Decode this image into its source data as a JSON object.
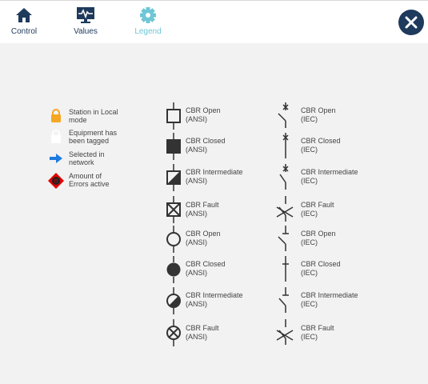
{
  "nav": {
    "tabs": [
      {
        "label": "Control",
        "icon": "home-icon"
      },
      {
        "label": "Values",
        "icon": "monitor-icon"
      },
      {
        "label": "Legend",
        "icon": "gear-icon",
        "active": true
      }
    ],
    "close_icon": "close-icon"
  },
  "colors": {
    "navy": "#1e3a5c",
    "accent": "#6ec6d6",
    "local_mode": "#f5a623",
    "tagged": "#ffffff",
    "selected": "#1e7be0",
    "errors": "#e00000"
  },
  "legend": [
    {
      "icon": "lock-icon",
      "l1": "Station in Local",
      "l2": "mode"
    },
    {
      "icon": "tag-icon",
      "l1": "Equipment has",
      "l2": "been tagged"
    },
    {
      "icon": "arrow-right-icon",
      "l1": "Selected in",
      "l2": "network"
    },
    {
      "icon": "error-diamond-icon",
      "badge": "!!",
      "l1": "Amount of",
      "l2": "Errors active"
    }
  ],
  "symbols": {
    "ansi": [
      {
        "l1": "CBR Open",
        "l2": "(ANSI)"
      },
      {
        "l1": "CBR Closed",
        "l2": "(ANSI)"
      },
      {
        "l1": "CBR Intermediate",
        "l2": "(ANSI)"
      },
      {
        "l1": "CBR Fault",
        "l2": "(ANSI)"
      },
      {
        "l1": "CBR Open",
        "l2": "(ANSI)"
      },
      {
        "l1": "CBR Closed",
        "l2": "(ANSI)"
      },
      {
        "l1": "CBR Intermediate",
        "l2": "(ANSI)"
      },
      {
        "l1": "CBR Fault",
        "l2": "(ANSI)"
      }
    ],
    "iec": [
      {
        "l1": "CBR Open",
        "l2": "(IEC)"
      },
      {
        "l1": "CBR Closed",
        "l2": "(IEC)"
      },
      {
        "l1": "CBR Intermediate",
        "l2": "(IEC)"
      },
      {
        "l1": "CBR Fault",
        "l2": "(IEC)"
      },
      {
        "l1": "CBR Open",
        "l2": "(IEC)"
      },
      {
        "l1": "CBR Closed",
        "l2": "(IEC)"
      },
      {
        "l1": "CBR Intermediate",
        "l2": "(IEC)"
      },
      {
        "l1": "CBR Fault",
        "l2": "(IEC)"
      }
    ]
  }
}
